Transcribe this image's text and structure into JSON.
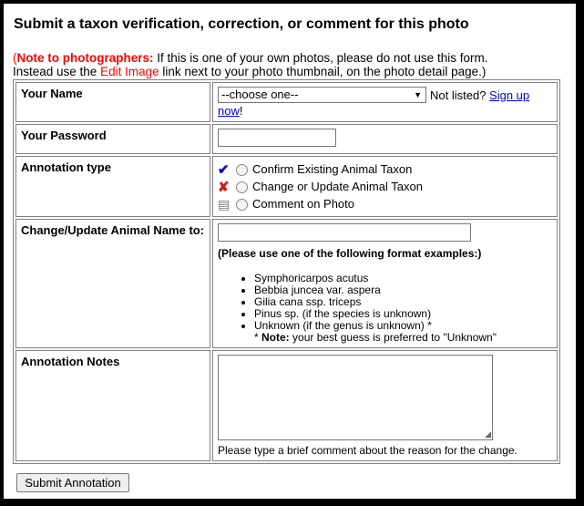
{
  "title": "Submit a taxon verification, correction, or comment for this photo",
  "note": {
    "open_paren": "(",
    "label": "Note to photographers:",
    "line1": " If this is one of your own photos, please do not use this form.",
    "line2_pre": "Instead use the ",
    "link": "Edit Image",
    "line2_post": " link next to your photo thumbnail, on the photo detail page.)"
  },
  "name_row": {
    "label": "Your Name",
    "select_value": "--choose one--",
    "not_listed": "Not listed? ",
    "signup_link": "Sign up now",
    "exclaim": "!"
  },
  "password_row": {
    "label": "Your Password"
  },
  "annotation_row": {
    "label": "Annotation type",
    "options": [
      {
        "icon": "checkmark-icon",
        "label": "Confirm Existing Animal Taxon"
      },
      {
        "icon": "red-x-icon",
        "label": "Change or Update Animal Taxon"
      },
      {
        "icon": "document-icon",
        "label": "Comment on Photo"
      }
    ]
  },
  "change_row": {
    "label": "Change/Update Animal Name to:",
    "format_head": "(Please use one of the following format examples:)",
    "examples": [
      "Symphoricarpos acutus",
      "Bebbia juncea var. aspera",
      "Gilia cana ssp. triceps",
      "Pinus sp. (if the species is unknown)",
      "Unknown (if the genus is unknown) *"
    ],
    "best_guess_prefix": "* ",
    "best_guess_bold": "Note:",
    "best_guess_text": " your best guess is preferred to \"Unknown\""
  },
  "notes_row": {
    "label": "Annotation Notes",
    "help": "Please type a brief comment about the reason for the change."
  },
  "submit_label": "Submit Annotation",
  "colors": {
    "accent_red": "#ff0000",
    "link_blue": "#0000ee",
    "check_blue": "#0000cc",
    "x_red": "#d61414"
  }
}
